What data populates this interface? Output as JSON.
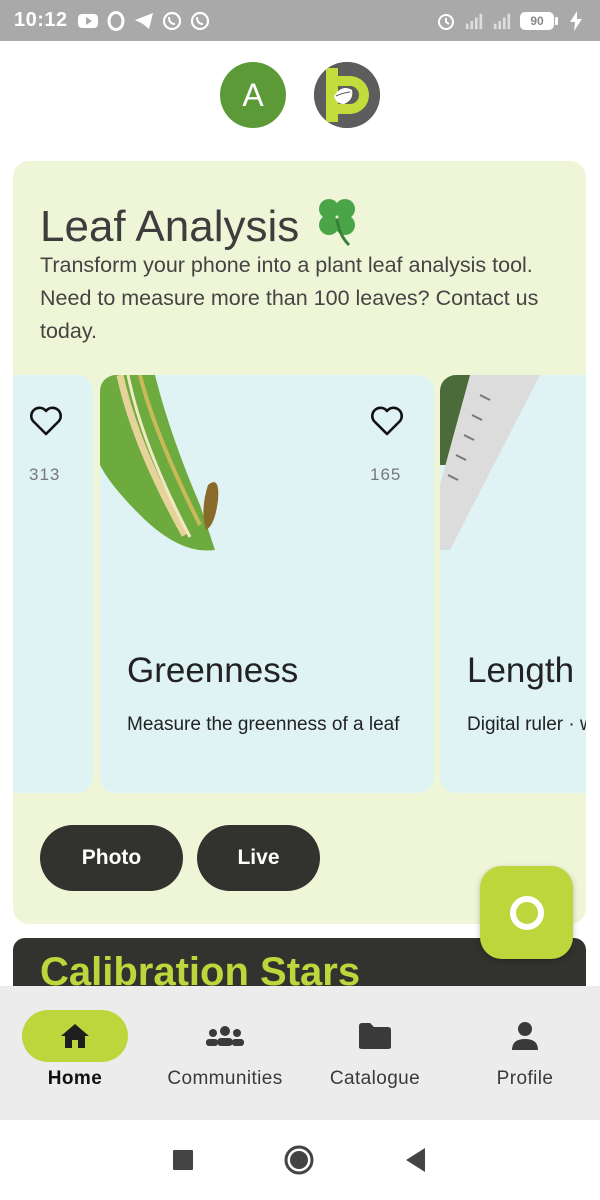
{
  "status_bar": {
    "time": "10:12",
    "battery": "90",
    "icons": [
      "youtube-icon",
      "opera-icon",
      "telegram-icon",
      "viber-icon",
      "viber-icon",
      "alarm-icon",
      "signal-icon",
      "signal-icon",
      "charging-icon"
    ]
  },
  "header": {
    "avatar_letter": "A",
    "logo": "app-logo-icon"
  },
  "hero": {
    "title": "Leaf Analysis",
    "emoji": "🍀",
    "description": "Transform your phone into a plant leaf analysis tool. Need to measure more than 100 leaves? Contact us today."
  },
  "cards": [
    {
      "likes": "313"
    },
    {
      "likes": "165",
      "title": "Greenness",
      "subtitle": "Measure the greenness of a leaf"
    },
    {
      "title": "Length",
      "subtitle": "Digital ruler · width & leng"
    }
  ],
  "buttons": {
    "photo": "Photo",
    "live": "Live"
  },
  "calibration": {
    "title": "Calibration Stars"
  },
  "bottom_nav": {
    "items": [
      {
        "label": "Home",
        "icon": "home-icon",
        "active": true
      },
      {
        "label": "Communities",
        "icon": "group-icon",
        "active": false
      },
      {
        "label": "Catalogue",
        "icon": "folder-icon",
        "active": false
      },
      {
        "label": "Profile",
        "icon": "person-icon",
        "active": false
      }
    ]
  },
  "colors": {
    "accent": "#bcd63c",
    "hero_bg": "#eff6d8",
    "card_bg": "#dff3f5",
    "dark": "#32332e",
    "avatar": "#5c9a38"
  }
}
